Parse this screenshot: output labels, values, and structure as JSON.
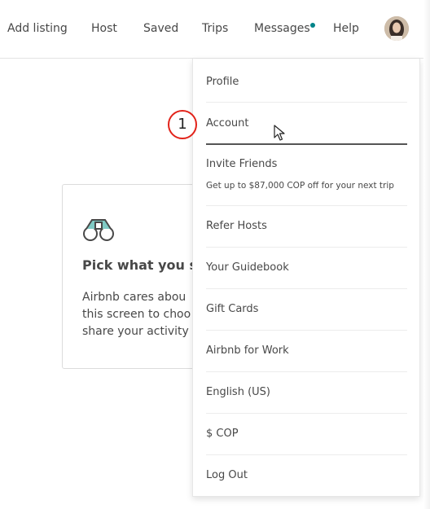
{
  "nav": {
    "add_listing": "Add listing",
    "host": "Host",
    "saved": "Saved",
    "trips": "Trips",
    "messages": "Messages",
    "help": "Help",
    "accent_color": "#008489"
  },
  "card": {
    "icon": "binoculars-icon",
    "title": "Pick what you sl",
    "lines": [
      "Airbnb cares abou",
      "this screen to choo",
      "share your activity"
    ]
  },
  "menu": {
    "items": [
      {
        "label": "Profile"
      },
      {
        "label": "Account"
      },
      {
        "label": "Invite Friends",
        "sub": "Get up to $87,000 COP off for your next trip"
      },
      {
        "label": "Refer Hosts"
      },
      {
        "label": "Your Guidebook"
      },
      {
        "label": "Gift Cards"
      },
      {
        "label": "Airbnb for Work"
      },
      {
        "label": "English (US)"
      },
      {
        "label": "$ COP"
      },
      {
        "label": "Log Out"
      }
    ]
  },
  "annotation": {
    "step_number": "1",
    "color": "#e2231a"
  }
}
